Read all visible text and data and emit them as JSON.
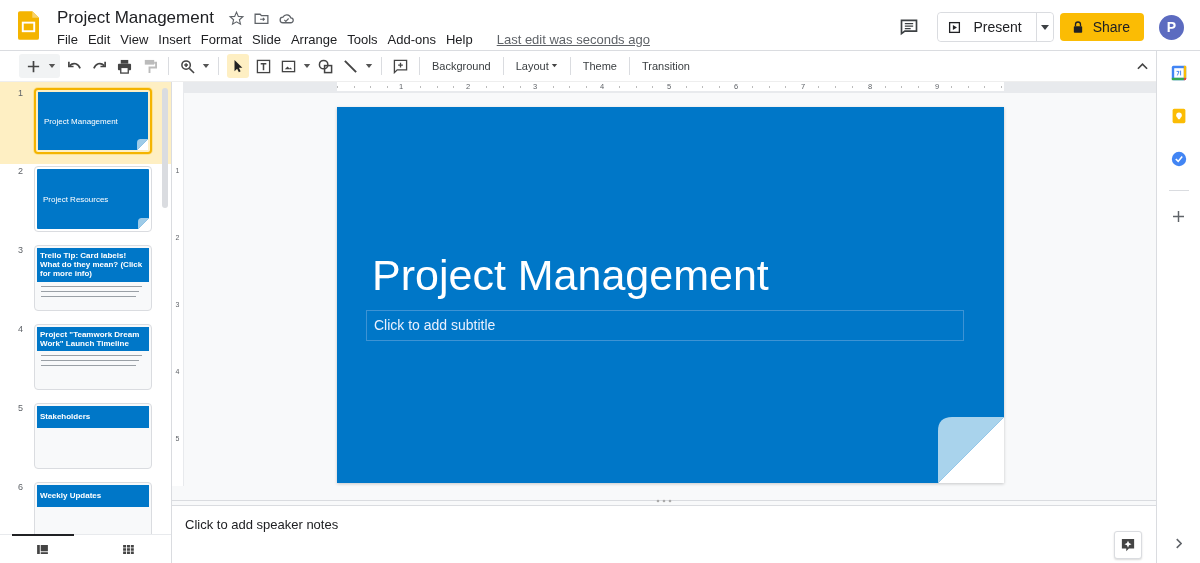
{
  "document": {
    "title": "Project Management",
    "last_edit": "Last edit was seconds ago"
  },
  "menu": [
    "File",
    "Edit",
    "View",
    "Insert",
    "Format",
    "Slide",
    "Arrange",
    "Tools",
    "Add-ons",
    "Help"
  ],
  "header_buttons": {
    "present": "Present",
    "share": "Share",
    "avatar": "P"
  },
  "toolbar": {
    "select_tool_selected": true,
    "text_buttons": [
      {
        "label": "Background",
        "dropdown": false
      },
      {
        "label": "Layout",
        "dropdown": true
      },
      {
        "label": "Theme",
        "dropdown": false
      },
      {
        "label": "Transition",
        "dropdown": false
      }
    ]
  },
  "ruler": {
    "horizontal": [
      "1",
      "2",
      "3",
      "4",
      "5",
      "6",
      "7",
      "8",
      "9"
    ],
    "vertical": [
      "1",
      "2",
      "3",
      "4",
      "5"
    ]
  },
  "slides": [
    {
      "number": "1",
      "kind": "title",
      "title": "Project Management",
      "selected": true
    },
    {
      "number": "2",
      "kind": "title",
      "title": "Project Resources",
      "selected": false
    },
    {
      "number": "3",
      "kind": "content",
      "title": "Trello Tip: Card labels! What do they mean? (Click for more info)",
      "body_text": true,
      "selected": false
    },
    {
      "number": "4",
      "kind": "content",
      "title": "Project \"Teamwork Dream Work\" Launch Timeline",
      "body_text": true,
      "selected": false
    },
    {
      "number": "5",
      "kind": "content",
      "title": "Stakeholders",
      "body_text": false,
      "selected": false
    },
    {
      "number": "6",
      "kind": "content",
      "title": "Weekly Updates",
      "body_text": false,
      "selected": false
    }
  ],
  "filmstrip_views": [
    {
      "kind": "list",
      "selected": true
    },
    {
      "kind": "grid",
      "selected": false
    }
  ],
  "current_slide": {
    "title": "Project Management",
    "subtitle_placeholder": "Click to add subtitle"
  },
  "speaker_notes": {
    "placeholder": "Click to add speaker notes"
  }
}
